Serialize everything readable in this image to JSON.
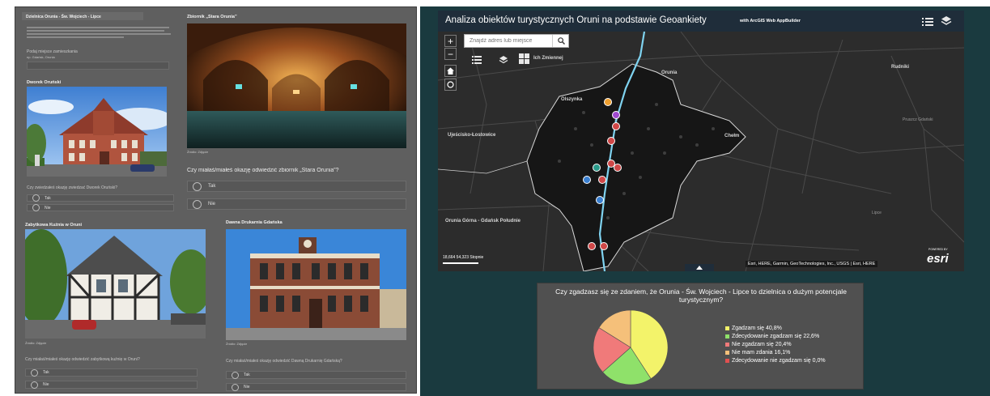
{
  "survey": {
    "heading": "Dzielnica Orunia - Św. Wojciech - Lipce",
    "intro_lines": 4,
    "question_place": "Podaj miejsce zamieszkania",
    "question_place_hint": "np. Gdańsk, Orunia",
    "section_dworek": {
      "title": "Dworek Oruński",
      "question": "Czy zwiedzałeś okazję zwiedzać Dworek Oruński?",
      "options": [
        "Tak",
        "Nie"
      ]
    },
    "section_zbiornik": {
      "title": "Zbiornik „Stara Orunia”",
      "caption": "Źródło: Zdjęcie",
      "question": "Czy miałaś/miałeś okazję odwiedzić zbiornik „Stara Orunia”?",
      "options": [
        "Tak",
        "Nie"
      ]
    },
    "section_kuznia": {
      "title": "Zabytkowa Kuźnia w Oruni",
      "caption": "Źródło: Zdjęcie",
      "question": "Czy miałaś/miałeś okazję odwiedzić zabytkową kuźnię w Oruni?",
      "options": [
        "Tak",
        "Nie"
      ]
    },
    "section_drukarnia": {
      "title": "Dawna Drukarnia Gdańska",
      "caption": "Źródło: Zdjęcie",
      "question": "Czy miałaś/miałeś okazję odwiedzić Dawną Drukarnię Gdańską?",
      "options": [
        "Tak",
        "Nie"
      ]
    }
  },
  "mapapp": {
    "title": "Analiza obiektów turystycznych Oruni na podstawie Geoankiety",
    "subtitle": "with ArcGIS Web AppBuilder",
    "search_placeholder": "Znajdź adres lub miejsce",
    "zoom_in": "+",
    "zoom_out": "−",
    "home_icon": "home-icon",
    "locate_icon": "locate-icon",
    "toolbar_label": "Ich Zmiennej",
    "places": [
      "Orunia",
      "Ujeścisko-Łostowice",
      "Olszynka",
      "Chełm",
      "Orunia Górna - Gdańsk Południe",
      "Rudniki",
      "Pruszcz Gdański",
      "Lipce"
    ],
    "scale_text": "18,664 54,323 Stopnie",
    "attribution": "Esri, HERE, Garmin, GeoTechnologies, Inc., USGS | Esri, HERE",
    "logo": "esri",
    "logo_prefix": "POWERED BY",
    "collapse_icon": "chevron-up-icon",
    "colors": {
      "bar": "#1f2d3a",
      "river": "#7fd3f0",
      "district": "#161616"
    }
  },
  "chart_data": {
    "type": "pie",
    "title": "Czy zgadzasz się ze zdaniem, że Orunia - Św. Wojciech - Lipce to dzielnica o dużym potencjale turystycznym?",
    "series": [
      {
        "name": "Zgadzam się 40,8%",
        "value": 40.8,
        "color": "#f3f36a"
      },
      {
        "name": "Zdecydowanie zgadzam się 22,6%",
        "value": 22.6,
        "color": "#8fe16a"
      },
      {
        "name": "Nie zgadzam się 20,4%",
        "value": 20.4,
        "color": "#f07a7a"
      },
      {
        "name": "Nie mam zdania 16,1%",
        "value": 16.1,
        "color": "#f5c07a"
      },
      {
        "name": "Zdecydowanie nie zgadzam się 0,0%",
        "value": 0.0,
        "color": "#e05050"
      }
    ],
    "legend_position": "right"
  }
}
